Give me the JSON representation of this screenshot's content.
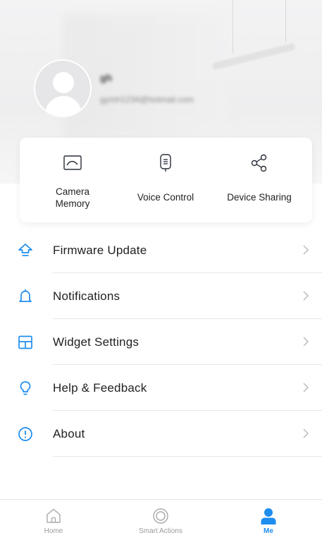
{
  "profile": {
    "name": "gh",
    "email": "gymh1234@hotmail.com"
  },
  "quick_actions": [
    {
      "label": "Camera\nMemory",
      "icon": "camera-memory-icon"
    },
    {
      "label": "Voice Control",
      "icon": "voice-control-icon"
    },
    {
      "label": "Device Sharing",
      "icon": "share-icon"
    }
  ],
  "menu": {
    "items": [
      {
        "label": "Firmware Update",
        "icon": "firmware-update-icon"
      },
      {
        "label": "Notifications",
        "icon": "bell-icon"
      },
      {
        "label": "Widget Settings",
        "icon": "widget-icon"
      },
      {
        "label": "Help & Feedback",
        "icon": "lightbulb-icon"
      },
      {
        "label": "About",
        "icon": "info-icon"
      }
    ]
  },
  "tabbar": {
    "tabs": [
      {
        "label": "Home",
        "icon": "home-icon",
        "active": false
      },
      {
        "label": "Smart Actions",
        "icon": "smart-actions-icon",
        "active": false
      },
      {
        "label": "Me",
        "icon": "person-icon",
        "active": true
      }
    ]
  },
  "colors": {
    "accent": "#1e8df0",
    "icon_dark": "#2a2f3a",
    "chevron": "#b8b8b8",
    "inactive_tab": "#9a9a9a"
  }
}
